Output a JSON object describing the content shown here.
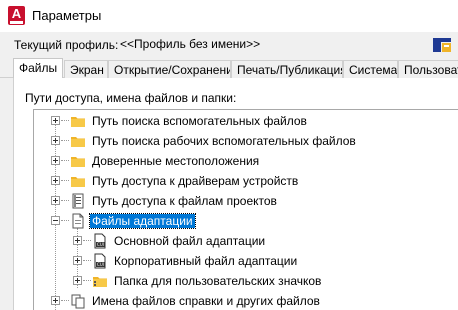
{
  "window": {
    "title": "Параметры",
    "app_icon_letter": "A"
  },
  "profile": {
    "label": "Текущий профиль:",
    "value": "<<Профиль без имени>>"
  },
  "tabs": [
    {
      "label": "Файлы",
      "active": true
    },
    {
      "label": "Экран",
      "active": false
    },
    {
      "label": "Открытие/Сохранение",
      "active": false
    },
    {
      "label": "Печать/Публикация",
      "active": false
    },
    {
      "label": "Система",
      "active": false
    },
    {
      "label": "Пользовательские",
      "active": false
    }
  ],
  "files_panel": {
    "paths_label": "Пути доступа, имена файлов и папки:",
    "tree": [
      {
        "label": "Путь поиска вспомогательных файлов",
        "icon": "folder-icon",
        "expanded": false,
        "level": 0
      },
      {
        "label": "Путь поиска рабочих вспомогательных файлов",
        "icon": "folder-icon",
        "expanded": false,
        "level": 0
      },
      {
        "label": "Доверенные местоположения",
        "icon": "folder-icon",
        "expanded": false,
        "level": 0
      },
      {
        "label": "Путь доступа к драйверам устройств",
        "icon": "folder-icon",
        "expanded": false,
        "level": 0
      },
      {
        "label": "Путь доступа к файлам проектов",
        "icon": "project-files-icon",
        "expanded": false,
        "level": 0
      },
      {
        "label": "Файлы адаптации",
        "icon": "document-icon",
        "expanded": true,
        "level": 0,
        "selected": true
      },
      {
        "label": "Основной файл адаптации",
        "icon": "cui-file-icon",
        "expanded": false,
        "level": 1
      },
      {
        "label": "Корпоративный файл адаптации",
        "icon": "cui-file-icon",
        "expanded": false,
        "level": 1
      },
      {
        "label": "Папка для пользовательских значков",
        "icon": "folder-icon",
        "expanded": false,
        "level": 1
      },
      {
        "label": "Имена файлов справки и других файлов",
        "icon": "help-files-icon",
        "expanded": false,
        "level": 0
      }
    ]
  },
  "colors": {
    "selection": "#0078d7",
    "folder": "#f0b429",
    "app_icon": "#c8102e"
  }
}
